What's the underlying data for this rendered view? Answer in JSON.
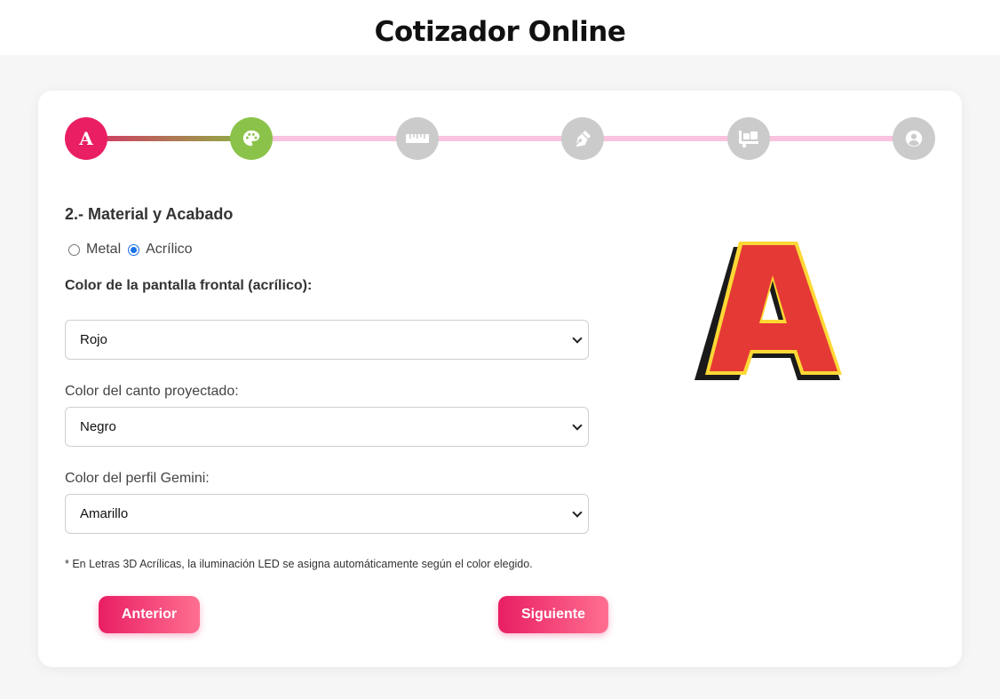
{
  "header": {
    "title": "Cotizador Online"
  },
  "stepper": {
    "steps": [
      {
        "icon": "letter-a-icon",
        "label": "A",
        "state": "done",
        "color": "#e91e63"
      },
      {
        "icon": "palette-icon",
        "state": "active",
        "color": "#8bc34a"
      },
      {
        "icon": "ruler-icon",
        "state": "pending",
        "color": "#cbcbcb"
      },
      {
        "icon": "pen-nib-icon",
        "state": "pending",
        "color": "#cbcbcb"
      },
      {
        "icon": "truck-ramp-icon",
        "state": "pending",
        "color": "#cbcbcb"
      },
      {
        "icon": "user-circle-icon",
        "state": "pending",
        "color": "#cbcbcb"
      }
    ]
  },
  "form": {
    "section_title": "2.- Material y Acabado",
    "material_options": [
      {
        "label": "Metal",
        "checked": false
      },
      {
        "label": "Acrílico",
        "checked": true
      }
    ],
    "front_color_label": "Color de la pantalla frontal (acrílico):",
    "front_color_value": "Rojo",
    "edge_color_label": "Color del canto proyectado:",
    "edge_color_value": "Negro",
    "profile_color_label": "Color del perfil Gemini:",
    "profile_color_value": "Amarillo",
    "note": "* En Letras 3D Acrílicas, la iluminación LED se asigna automáticamente según el color elegido.",
    "prev_label": "Anterior",
    "next_label": "Siguiente"
  },
  "preview": {
    "letter": "A",
    "face_color": "#e53935",
    "edge_color": "#1a1a1a",
    "outline_color": "#fdd835"
  },
  "colors": {
    "accent": "#e91e63",
    "active_step": "#8bc34a",
    "track": "#f9c2de"
  }
}
